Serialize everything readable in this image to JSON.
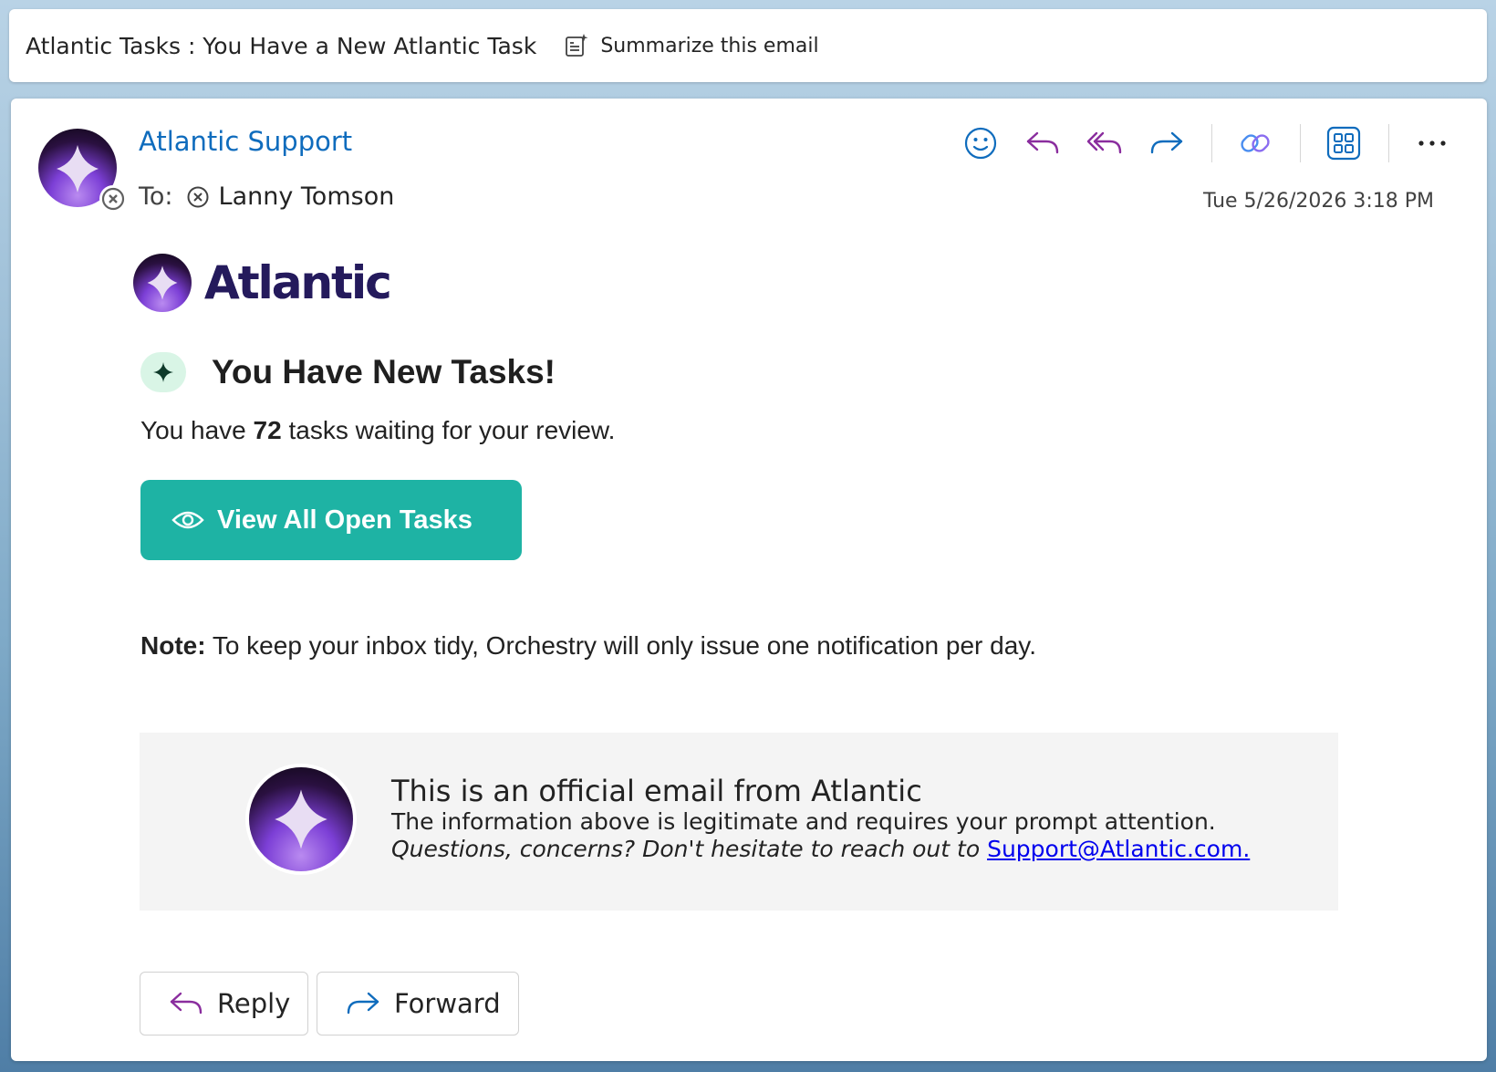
{
  "subject_bar": {
    "title": "Atlantic Tasks : You Have a New Atlantic Task",
    "summarize_label": "Summarize this email"
  },
  "header": {
    "sender": "Atlantic Support",
    "to_label": "To:",
    "recipient": "Lanny Tomson",
    "date": "Tue 5/26/2026 3:18 PM"
  },
  "toolbar": {
    "icons": [
      "emoji-icon",
      "reply-icon",
      "reply-all-icon",
      "forward-icon",
      "link-icon",
      "apps-icon",
      "more-icon"
    ]
  },
  "body": {
    "brand_name": "Atlantic",
    "headline": "You Have New Tasks!",
    "tasks_prefix": "You have ",
    "task_count": "72",
    "tasks_suffix": " tasks waiting for your review.",
    "cta_label": "View All Open Tasks",
    "note_label": "Note:",
    "note_text": " To keep your inbox tidy, Orchestry will only issue one notification per day."
  },
  "footer": {
    "title": "This is an official email from Atlantic",
    "line": "The information above is legitimate and requires your prompt attention.",
    "question": "Questions, concerns? Don't hesitate to reach out to ",
    "email": "Support@Atlantic.com."
  },
  "actions": {
    "reply_label": "Reply",
    "forward_label": "Forward"
  },
  "colors": {
    "accent": "#0f6cbd",
    "cta": "#1eb3a4",
    "brand": "#241a5c",
    "reply_icon": "#8a2d9e"
  }
}
